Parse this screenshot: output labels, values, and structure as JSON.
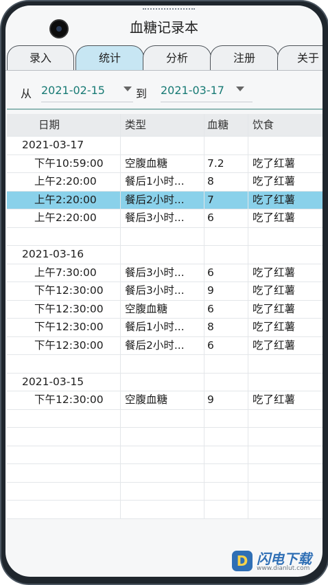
{
  "app": {
    "title": "血糖记录本"
  },
  "tabs": [
    {
      "label": "录入",
      "active": false
    },
    {
      "label": "统计",
      "active": true
    },
    {
      "label": "分析",
      "active": false
    },
    {
      "label": "注册",
      "active": false
    },
    {
      "label": "关于",
      "active": false
    }
  ],
  "filter": {
    "from_label": "从",
    "from_date": "2021-02-15",
    "to_label": "到",
    "to_date": "2021-03-17"
  },
  "table": {
    "headers": [
      "日期",
      "类型",
      "血糖",
      "饮食"
    ],
    "rows": [
      {
        "kind": "date",
        "date": "2021-03-17"
      },
      {
        "kind": "entry",
        "time": "下午10:59:00",
        "type": "空腹血糖",
        "glucose": "7.2",
        "food": "吃了红薯"
      },
      {
        "kind": "entry",
        "time": "上午2:20:00",
        "type": "餐后1小时...",
        "glucose": "8",
        "food": "吃了红薯"
      },
      {
        "kind": "entry",
        "time": "上午2:20:00",
        "type": "餐后2小时...",
        "glucose": "7",
        "food": "吃了红薯",
        "selected": true
      },
      {
        "kind": "entry",
        "time": "上午2:20:00",
        "type": "餐后3小时...",
        "glucose": "6",
        "food": "吃了红薯"
      },
      {
        "kind": "blank"
      },
      {
        "kind": "date",
        "date": "2021-03-16"
      },
      {
        "kind": "entry",
        "time": "上午7:30:00",
        "type": "餐后3小时...",
        "glucose": "6",
        "food": "吃了红薯"
      },
      {
        "kind": "entry",
        "time": "下午12:30:00",
        "type": "餐后3小时...",
        "glucose": "9",
        "food": "吃了红薯"
      },
      {
        "kind": "entry",
        "time": "下午12:30:00",
        "type": "空腹血糖",
        "glucose": "6",
        "food": "吃了红薯"
      },
      {
        "kind": "entry",
        "time": "下午12:30:00",
        "type": "餐后1小时...",
        "glucose": "8",
        "food": "吃了红薯"
      },
      {
        "kind": "entry",
        "time": "下午12:30:00",
        "type": "餐后2小时...",
        "glucose": "6",
        "food": "吃了红薯"
      },
      {
        "kind": "blank"
      },
      {
        "kind": "date",
        "date": "2021-03-15"
      },
      {
        "kind": "entry",
        "time": "下午12:30:00",
        "type": "空腹血糖",
        "glucose": "9",
        "food": "吃了红薯"
      },
      {
        "kind": "blank"
      },
      {
        "kind": "blank"
      },
      {
        "kind": "blank"
      },
      {
        "kind": "blank"
      },
      {
        "kind": "blank"
      },
      {
        "kind": "blank"
      }
    ]
  },
  "watermark": {
    "logo": "D",
    "text": "闪电下载",
    "url": "www.dianlut.com"
  },
  "colors": {
    "selected_row": "#8ad1ea",
    "active_tab": "#c7e6f3",
    "date_text": "#177a74"
  }
}
